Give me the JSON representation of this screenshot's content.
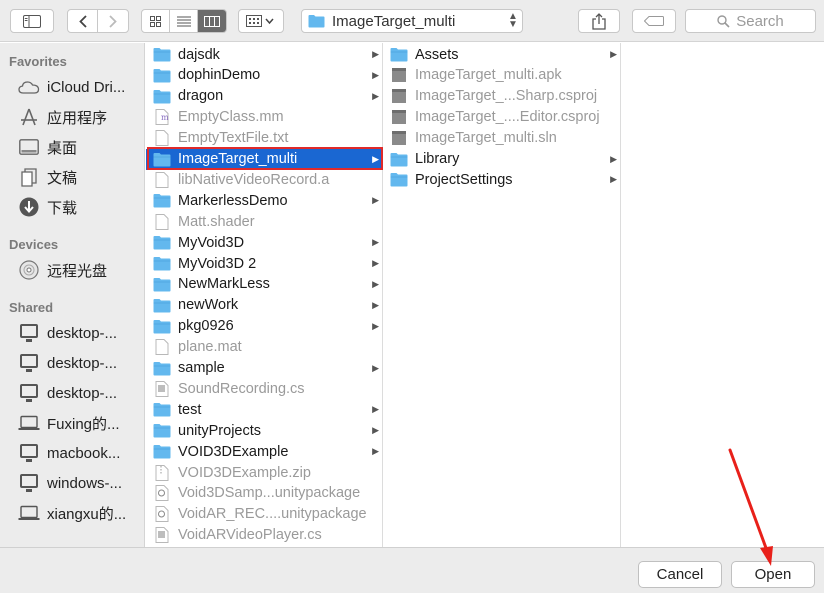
{
  "toolbar": {
    "path_title": "ImageTarget_multi",
    "search_placeholder": "Search",
    "icons": [
      "sidebar-toggle-icon",
      "back-icon",
      "forward-icon",
      "icon-view-icon",
      "list-view-icon",
      "column-view-icon",
      "group-icon",
      "share-icon",
      "tag-icon",
      "search-icon"
    ]
  },
  "sidebar": {
    "favorites_header": "Favorites",
    "favorites": [
      "iCloud Dri...",
      "应用程序",
      "桌面",
      "文稿",
      "下载"
    ],
    "devices_header": "Devices",
    "devices": [
      "远程光盘"
    ],
    "shared_header": "Shared",
    "shared": [
      "desktop-...",
      "desktop-...",
      "desktop-...",
      "Fuxing的...",
      "macbook...",
      "windows-...",
      "xiangxu的..."
    ]
  },
  "column1": [
    {
      "name": "dajsdk",
      "type": "folder",
      "arrow": true
    },
    {
      "name": "dophinDemo",
      "type": "folder",
      "arrow": true
    },
    {
      "name": "dragon",
      "type": "folder",
      "arrow": true
    },
    {
      "name": "EmptyClass.mm",
      "type": "file-m",
      "arrow": false
    },
    {
      "name": "EmptyTextFile.txt",
      "type": "file",
      "arrow": false
    },
    {
      "name": "ImageTarget_multi",
      "type": "folder",
      "arrow": true,
      "selected": true
    },
    {
      "name": "libNativeVideoRecord.a",
      "type": "file",
      "arrow": false
    },
    {
      "name": "MarkerlessDemo",
      "type": "folder",
      "arrow": true
    },
    {
      "name": "Matt.shader",
      "type": "file",
      "arrow": false
    },
    {
      "name": "MyVoid3D",
      "type": "folder",
      "arrow": true
    },
    {
      "name": "MyVoid3D 2",
      "type": "folder",
      "arrow": true
    },
    {
      "name": "NewMarkLess",
      "type": "folder",
      "arrow": true
    },
    {
      "name": "newWork",
      "type": "folder",
      "arrow": true
    },
    {
      "name": "pkg0926",
      "type": "folder",
      "arrow": true
    },
    {
      "name": "plane.mat",
      "type": "file",
      "arrow": false
    },
    {
      "name": "sample",
      "type": "folder",
      "arrow": true
    },
    {
      "name": "SoundRecording.cs",
      "type": "file-doc",
      "arrow": false
    },
    {
      "name": "test",
      "type": "folder",
      "arrow": true
    },
    {
      "name": "unityProjects",
      "type": "folder",
      "arrow": true
    },
    {
      "name": "VOID3DExample",
      "type": "folder",
      "arrow": true
    },
    {
      "name": "VOID3DExample.zip",
      "type": "file-zip",
      "arrow": false
    },
    {
      "name": "Void3DSamp...unitypackage",
      "type": "file-unity",
      "arrow": false
    },
    {
      "name": "VoidAR_REC....unitypackage",
      "type": "file-unity",
      "arrow": false
    },
    {
      "name": "VoidARVideoPlayer.cs",
      "type": "file-doc",
      "arrow": false
    }
  ],
  "column2": [
    {
      "name": "Assets",
      "type": "folder",
      "arrow": true
    },
    {
      "name": "ImageTarget_multi.apk",
      "type": "file-gray",
      "arrow": false
    },
    {
      "name": "ImageTarget_...Sharp.csproj",
      "type": "file-gray",
      "arrow": false
    },
    {
      "name": "ImageTarget_....Editor.csproj",
      "type": "file-gray",
      "arrow": false
    },
    {
      "name": "ImageTarget_multi.sln",
      "type": "file-gray",
      "arrow": false
    },
    {
      "name": "Library",
      "type": "folder",
      "arrow": true
    },
    {
      "name": "ProjectSettings",
      "type": "folder",
      "arrow": true
    }
  ],
  "buttons": {
    "cancel": "Cancel",
    "open": "Open"
  },
  "colors": {
    "selection": "#1a67d2",
    "highlight_box": "#e02a2a",
    "folder": "#63b8ee"
  }
}
